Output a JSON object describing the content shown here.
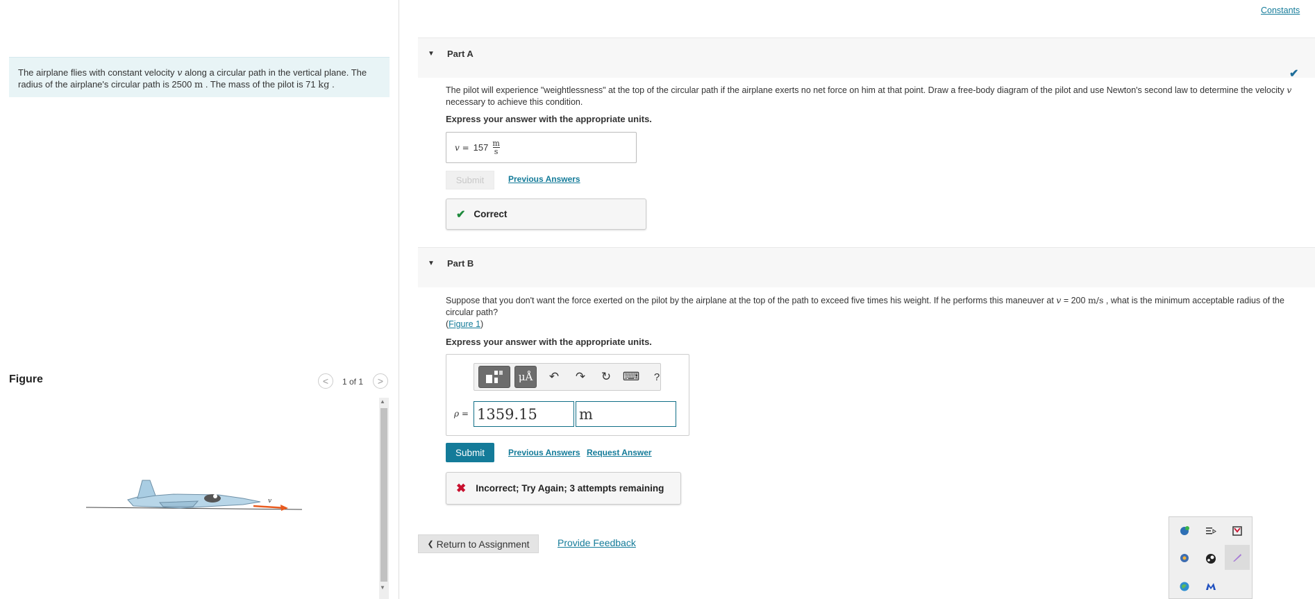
{
  "problem": {
    "text_1": "The airplane flies with constant velocity ",
    "var_v": "v",
    "text_2": " along a circular path in the vertical plane. The radius of the airplane's circular path is 2500 ",
    "unit_m": "m",
    "text_3": " . The mass of the pilot is 71 ",
    "unit_kg": "kg",
    "text_4": " ."
  },
  "figure": {
    "title": "Figure",
    "prev_icon": "<",
    "next_icon": ">",
    "counter": "1 of 1",
    "velocity_label": "v"
  },
  "constants_link": "Constants",
  "part_a": {
    "caret": "▼",
    "title": "Part A",
    "q_1": "The pilot will experience \"weightlessness\" at the top of the circular path if the airplane exerts no net force on him at that point. Draw a free-body diagram of the pilot and use Newton's second law to determine the velocity ",
    "q_var": "v",
    "q_2": " necessary to achieve this condition.",
    "express": "Express your answer with the appropriate units.",
    "answer_label": "v =",
    "answer_value": "157",
    "unit_num": "m",
    "unit_den": "s",
    "submit": "Submit",
    "previous_answers": "Previous Answers",
    "feedback_icon": "✔",
    "feedback": "Correct",
    "check": "✔"
  },
  "part_b": {
    "caret": "▼",
    "title": "Part B",
    "q_1": "Suppose that you don't want the force exerted on the pilot by the airplane at the top of the path to exceed five times his weight. If he performs this maneuver at ",
    "q_var": "v",
    "q_2": " = 200 ",
    "q_unit": "m/s",
    "q_3": " , what is the minimum acceptable radius of the circular path?",
    "figure_link": "Figure 1",
    "paren_open": "(",
    "paren_close": ")",
    "express": "Express your answer with the appropriate units.",
    "toolbar": {
      "units": "μÅ",
      "undo": "↶",
      "redo": "↷",
      "reset": "↻",
      "keyboard": "⌨",
      "help": "?"
    },
    "answer_label": "ρ =",
    "value": "1359.15",
    "unit": "m",
    "submit": "Submit",
    "previous_answers": "Previous Answers",
    "request_answer": "Request Answer",
    "feedback_icon": "✖",
    "feedback": "Incorrect; Try Again; 3 attempts remaining"
  },
  "footer": {
    "return_icon": "❮",
    "return_label": "Return to Assignment",
    "provide_feedback": "Provide Feedback"
  },
  "colors": {
    "accent": "#147b99",
    "correct": "#1e8a3c",
    "incorrect": "#c8102e",
    "problem_bg": "#e8f4f6"
  }
}
